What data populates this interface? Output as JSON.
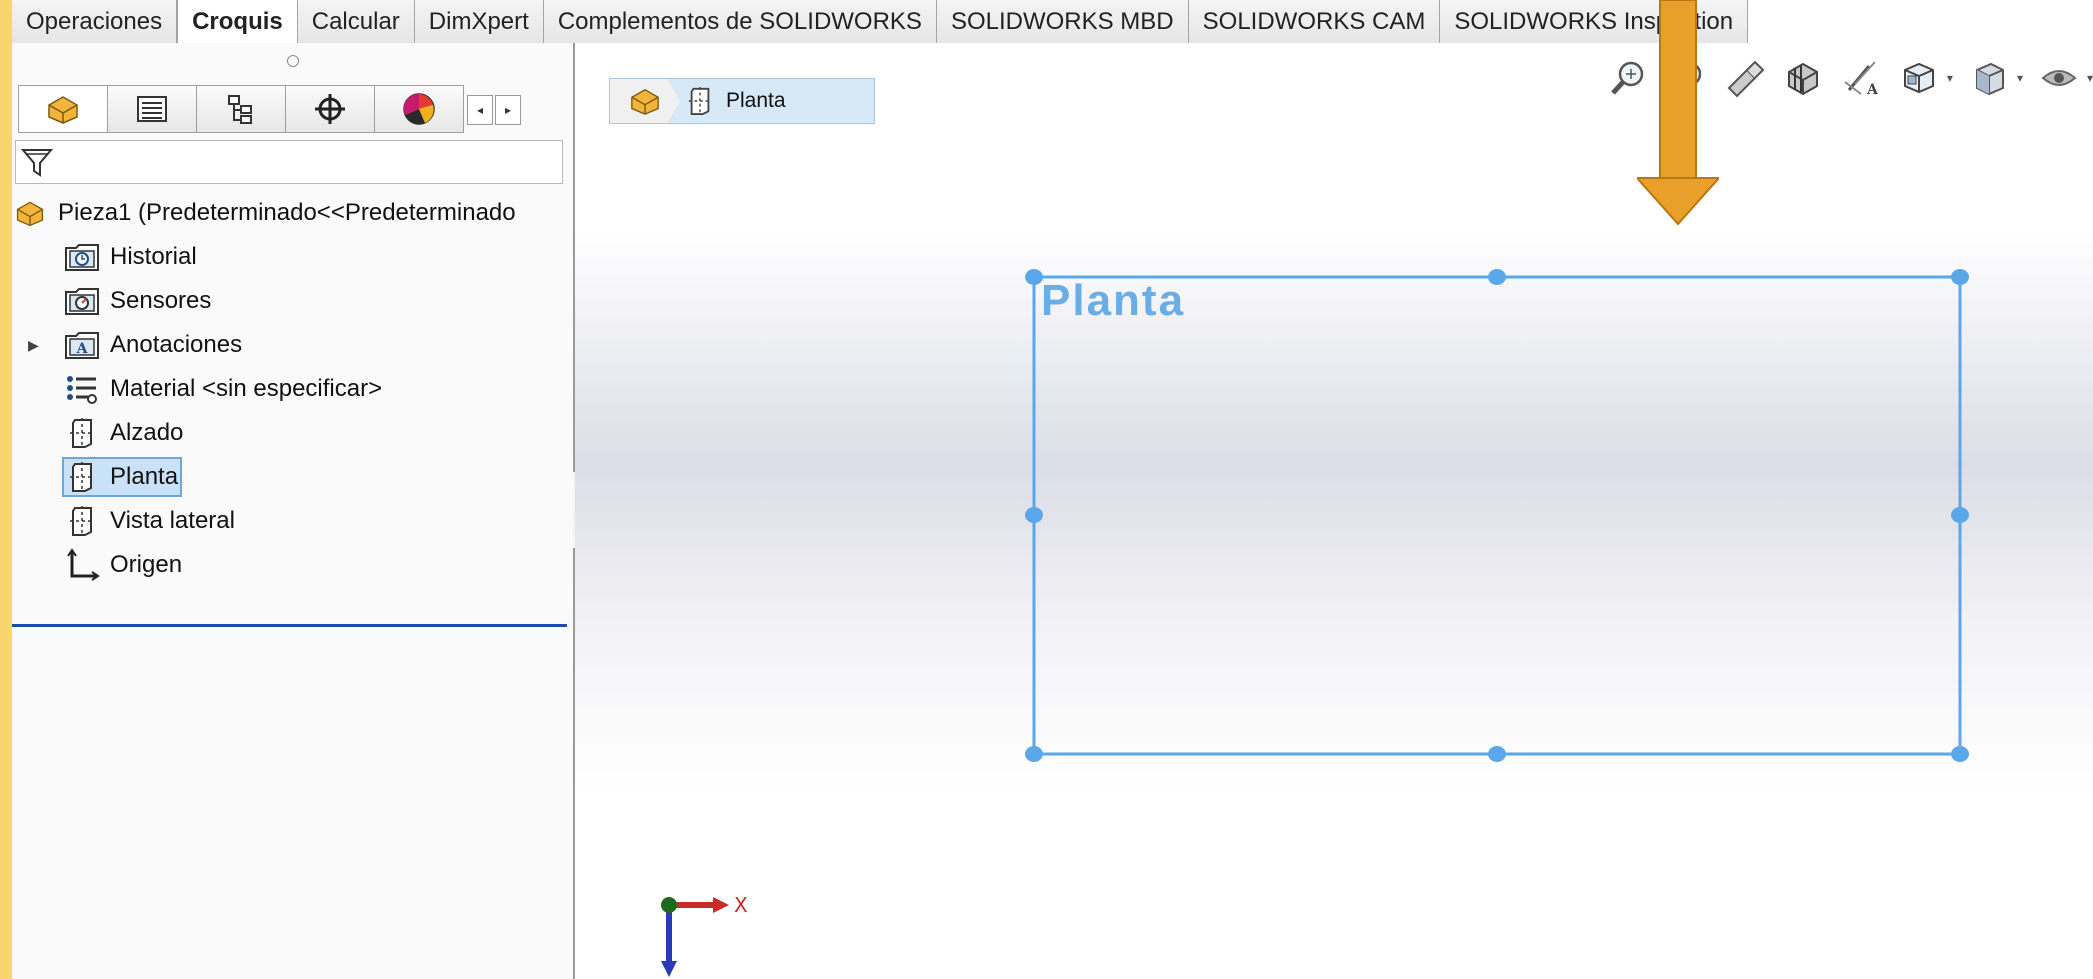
{
  "tabs": [
    {
      "label": "Operaciones",
      "active": false
    },
    {
      "label": "Croquis",
      "active": true
    },
    {
      "label": "Calcular",
      "active": false
    },
    {
      "label": "DimXpert",
      "active": false
    },
    {
      "label": "Complementos de SOLIDWORKS",
      "active": false
    },
    {
      "label": "SOLIDWORKS MBD",
      "active": false
    },
    {
      "label": "SOLIDWORKS CAM",
      "active": false
    },
    {
      "label": "SOLIDWORKS Inspection",
      "active": false
    }
  ],
  "manager_tabs": [
    "part-manager-icon",
    "property-manager-icon",
    "configuration-manager-icon",
    "dimxpert-manager-icon",
    "display-manager-icon"
  ],
  "tree": {
    "root": "Pieza1  (Predeterminado<<Predeterminado",
    "items": [
      {
        "label": "Historial",
        "icon": "history-folder-icon"
      },
      {
        "label": "Sensores",
        "icon": "sensors-folder-icon"
      },
      {
        "label": "Anotaciones",
        "icon": "annotations-folder-icon",
        "expandable": true
      },
      {
        "label": "Material <sin especificar>",
        "icon": "material-icon"
      },
      {
        "label": "Alzado",
        "icon": "plane-icon"
      },
      {
        "label": "Planta",
        "icon": "plane-icon",
        "selected": true
      },
      {
        "label": "Vista lateral",
        "icon": "plane-icon"
      },
      {
        "label": "Origen",
        "icon": "origin-icon"
      }
    ]
  },
  "breadcrumb": {
    "label": "Planta"
  },
  "viewport": {
    "plane_label": "Planta",
    "axis_x_label": "X",
    "plane_color": "#5aa7ea"
  },
  "hud_icons": [
    "zoom-to-fit-icon",
    "zoom-to-area-icon",
    "previous-view-icon",
    "section-view-icon",
    "dynamic-annotation-icon",
    "view-orientation-icon",
    "display-style-icon",
    "hide-show-items-icon"
  ],
  "colors": {
    "arrow": "#e8a02a",
    "selection": "#c9e2f7",
    "tree_end_line": "#1c4da8"
  }
}
